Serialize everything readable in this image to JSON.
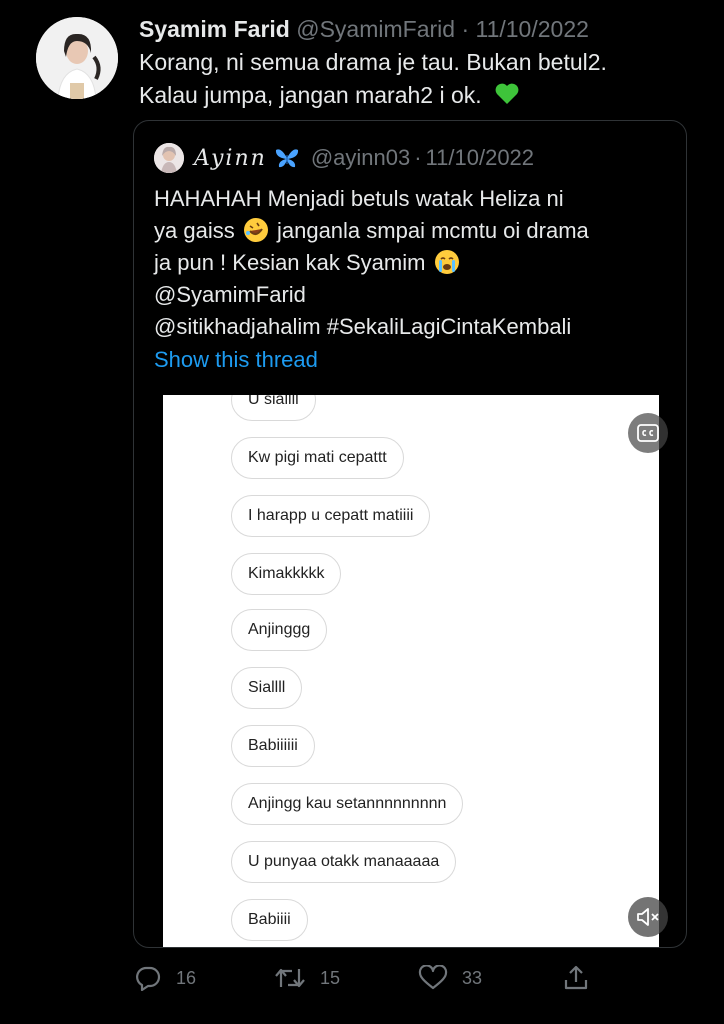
{
  "tweet": {
    "author_name": "Syamim Farid",
    "author_handle": "@SyamimFarid",
    "separator": "·",
    "date": "11/10/2022",
    "text_line1": "Korang, ni semua drama je tau. Bukan betul2.",
    "text_line2": "Kalau jumpa, jangan marah2 i ok.",
    "text_emoji": "green-heart-icon"
  },
  "quote": {
    "author_name": "Ayinn",
    "author_emoji": "butterfly-icon",
    "author_handle": "@ayinn03",
    "separator": "·",
    "date": "11/10/2022",
    "line1": "HAHAHAH Menjadi betuls watak Heliza ni",
    "line2_a": "ya gaiss",
    "line2_emoji": "rofl-emoji",
    "line2_b": "janganla smpai mcmtu oi drama",
    "line3_a": "ja pun ! Kesian kak Syamim",
    "line3_emoji": "crying-face-emoji",
    "line4": "@SyamimFarid",
    "line5": "@sitikhadjahalim #SekaliLagiCintaKembali",
    "show_thread": "Show this thread",
    "media": {
      "messages": [
        "U siallll",
        "Kw pigi mati cepattt",
        "I harapp u cepatt matiiii",
        "Kimakkkkk",
        "Anjinggg",
        "Siallll",
        "Babiiiiii",
        "Anjingg kau setannnnnnnnn",
        "U punyaa otakk manaaaaa",
        "Babiiii"
      ]
    }
  },
  "actions": {
    "replies": "16",
    "retweets": "15",
    "likes": "33"
  },
  "colors": {
    "background": "#000000",
    "text": "#e7e9ea",
    "muted": "#71767b",
    "link": "#1d9bf0",
    "border": "#2f3336"
  }
}
